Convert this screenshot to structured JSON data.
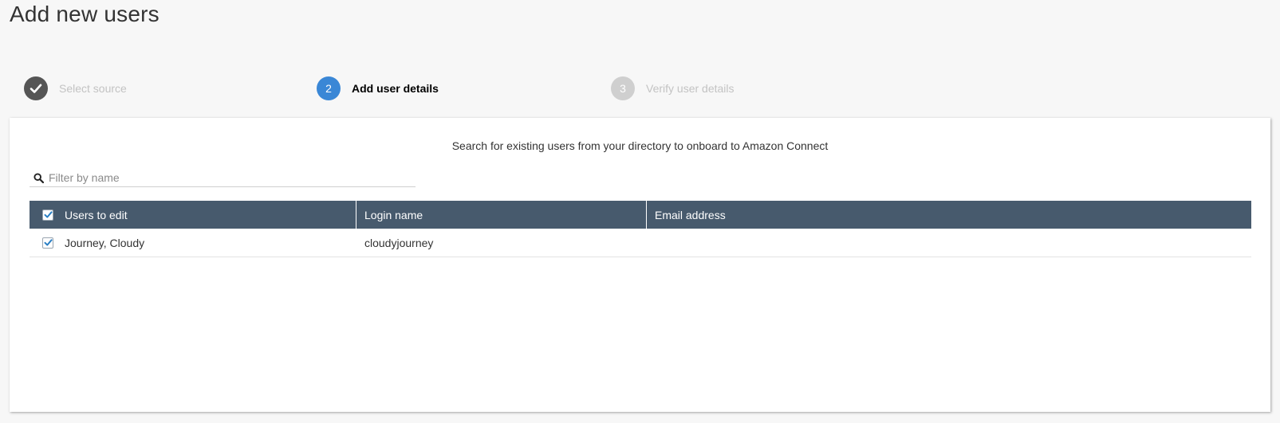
{
  "page": {
    "title": "Add new users"
  },
  "wizard": {
    "steps": [
      {
        "number": "",
        "label": "Select source",
        "state": "completed",
        "icon": "check-icon"
      },
      {
        "number": "2",
        "label": "Add user details",
        "state": "current"
      },
      {
        "number": "3",
        "label": "Verify user details",
        "state": "upcoming"
      }
    ]
  },
  "panel": {
    "instruction": "Search for existing users from your directory to onboard to Amazon Connect",
    "filter": {
      "placeholder": "Filter by name",
      "value": "",
      "icon": "search-icon"
    },
    "table": {
      "columns": [
        "Users to edit",
        "Login name",
        "Email address"
      ],
      "select_all_checked": true,
      "rows": [
        {
          "checked": true,
          "name": "Journey, Cloudy",
          "login": "cloudyjourney",
          "email": ""
        }
      ]
    }
  },
  "colors": {
    "header_bg": "#475a6d",
    "current_step": "#3a87d6",
    "completed_step": "#555555",
    "upcoming_step": "#cfcfcf",
    "checkbox_check": "#2a7fc4"
  }
}
